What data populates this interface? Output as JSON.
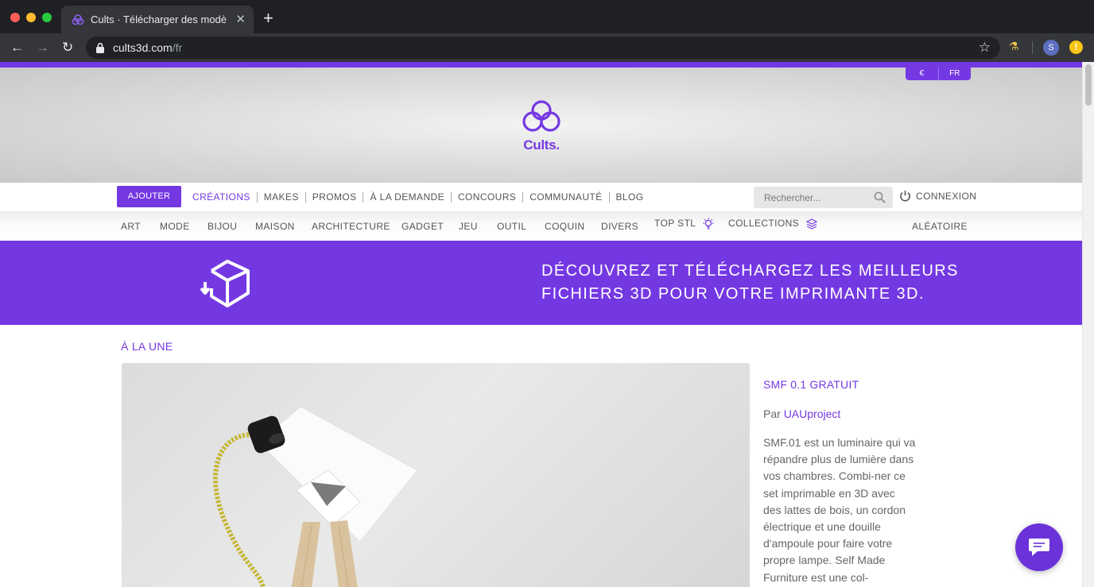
{
  "browser": {
    "tab_title": "Cults · Télécharger des modè",
    "url_host": "cults3d.com",
    "url_path": "/fr",
    "profile_initial": "S"
  },
  "header": {
    "currency": "€",
    "language": "FR",
    "logo_text": "Cults."
  },
  "main_nav": {
    "add_label": "AJOUTER",
    "items": [
      "CRÉATIONS",
      "MAKES",
      "PROMOS",
      "À LA DEMANDE",
      "CONCOURS",
      "COMMUNAUTÉ",
      "BLOG"
    ],
    "active_index": 0,
    "search_placeholder": "Rechercher...",
    "login_label": "CONNEXION"
  },
  "categories": {
    "items": [
      "ART",
      "MODE",
      "BIJOU",
      "MAISON",
      "ARCHITECTURE",
      "GADGET",
      "JEU",
      "OUTIL",
      "COQUIN",
      "DIVERS"
    ],
    "top_stl": "TOP STL",
    "collections": "COLLECTIONS",
    "random": "ALÉATOIRE"
  },
  "banner": {
    "line1": "DÉCOUVREZ ET TÉLÉCHARGEZ LES MEILLEURS",
    "line2": "FICHIERS 3D POUR VOTRE IMPRIMANTE 3D."
  },
  "featured": {
    "section_title": "À LA UNE",
    "title": "SMF 0.1 GRATUIT",
    "author_prefix": "Par",
    "author": "UAUproject",
    "description": "SMF.01 est un luminaire qui va répandre plus de lumière dans vos chambres. Combi-ner ce set imprimable en 3D avec des lattes de bois, un cordon électrique et une douille d'ampoule pour faire votre propre lampe. Self Made Furniture est une col-"
  },
  "colors": {
    "brand": "#7438e3"
  }
}
